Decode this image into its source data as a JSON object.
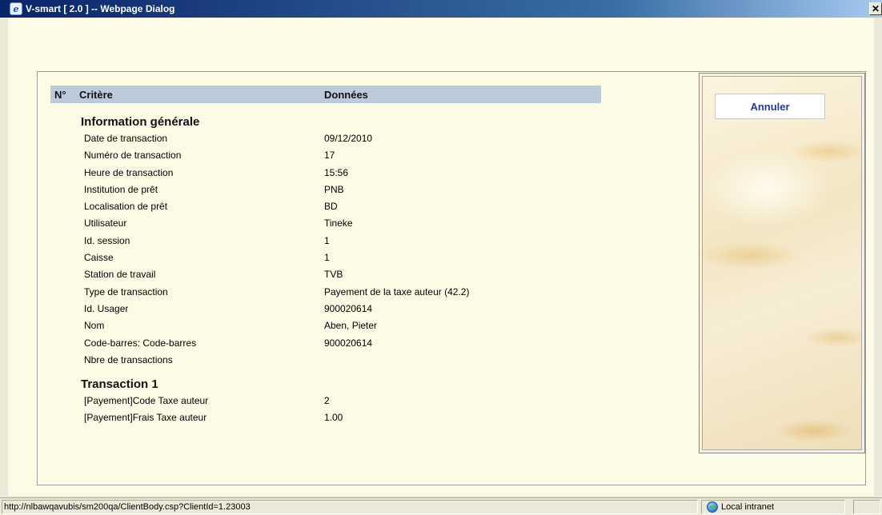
{
  "window": {
    "title": "V-smart [ 2.0 ] -- Webpage Dialog",
    "close_glyph": "✕",
    "app_icon_glyph": "e"
  },
  "table": {
    "headers": {
      "no": "N°",
      "criterion": "Critère",
      "data": "Données"
    },
    "section1": {
      "title": "Information générale",
      "rows": [
        {
          "label": "Date de transaction",
          "value": "09/12/2010"
        },
        {
          "label": "Numéro de transaction",
          "value": "17"
        },
        {
          "label": "Heure de transaction",
          "value": "15:56"
        },
        {
          "label": "Institution de prêt",
          "value": "PNB"
        },
        {
          "label": "Localisation de prêt",
          "value": "BD"
        },
        {
          "label": "Utilisateur",
          "value": "Tineke"
        },
        {
          "label": "Id. session",
          "value": "1"
        },
        {
          "label": "Caisse",
          "value": "1"
        },
        {
          "label": "Station de travail",
          "value": "TVB"
        },
        {
          "label": "Type de transaction",
          "value": "Payement de la taxe auteur (42.2)"
        },
        {
          "label": "Id. Usager",
          "value": "900020614"
        },
        {
          "label": "Nom",
          "value": "Aben, Pieter"
        },
        {
          "label": "Code-barres: Code-barres",
          "value": "900020614"
        },
        {
          "label": "Nbre de transactions",
          "value": ""
        }
      ]
    },
    "section2": {
      "title": "Transaction 1",
      "rows": [
        {
          "label": "[Payement]Code Taxe auteur",
          "value": "2"
        },
        {
          "label": "[Payement]Frais Taxe auteur",
          "value": "1.00"
        }
      ]
    }
  },
  "actions": {
    "cancel_label": "Annuler"
  },
  "statusbar": {
    "url": "http://nlbawqavubis/sm200qa/ClientBody.csp?ClientId=1.23003",
    "zone": "Local intranet"
  },
  "colors": {
    "header_bg": "#bccbdc",
    "content_bg": "#fbfbe6",
    "button_text": "#1f3e8a"
  }
}
